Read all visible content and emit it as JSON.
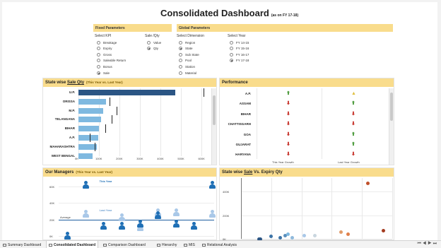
{
  "header": {
    "title": "Consolidated Dashboard",
    "subtitle": "(as on FY 17-18)"
  },
  "fixed_params": {
    "title": "Fixed Parameters",
    "kpi_label": "Select KPI",
    "unit_label": "Sale /Qty",
    "kpi_options": [
      "Breakage",
      "Expiry",
      "Gross",
      "Saleable Return",
      "Bonus",
      "Sale"
    ],
    "kpi_selected": "Sale",
    "unit_options": [
      "Value",
      "Qty"
    ],
    "unit_selected": "Qty"
  },
  "global_params": {
    "title": "Global Parameters",
    "dimension_label": "Select Dimension",
    "year_label": "Select Year",
    "dimension_options": [
      "Region",
      "State",
      "Sub State",
      "Pool",
      "Station",
      "Material"
    ],
    "dimension_selected": "State",
    "year_options": [
      "FY 14-15",
      "FY 15-16",
      "FY 16-17",
      "FY 17-18"
    ],
    "year_selected": "FY 17-18"
  },
  "state_sales": {
    "title_pre": "State wise",
    "title_kpi": "Sale Qty",
    "note": "(This Year vs. Last Year)",
    "axis_ticks": [
      "0K",
      "100K",
      "200K",
      "300K",
      "400K",
      "500K",
      "600K"
    ],
    "rows": [
      {
        "state": "U.P.",
        "this_year": 470000,
        "last_year": 610000,
        "highlight": true
      },
      {
        "state": "ORISSA",
        "this_year": 135000,
        "last_year": 150000
      },
      {
        "state": "M.P.",
        "this_year": 120000,
        "last_year": 185000
      },
      {
        "state": "TELANGANA",
        "this_year": 110000,
        "last_year": 160000
      },
      {
        "state": "BIHAR",
        "this_year": 100000,
        "last_year": 130000
      },
      {
        "state": "A.P.",
        "this_year": 95000,
        "last_year": 55000
      },
      {
        "state": "MAHARASHTRA",
        "this_year": 90000,
        "last_year": 80000
      },
      {
        "state": "WEST BENGAL",
        "this_year": 70000,
        "last_year": null
      }
    ]
  },
  "performance": {
    "title": "Performance",
    "col_this": "This Year Growth",
    "col_last": "Last Year Growth",
    "rows": [
      {
        "state": "A.P.",
        "this_year": "up",
        "last_year": "warn"
      },
      {
        "state": "ASSAM",
        "this_year": "down",
        "last_year": "up"
      },
      {
        "state": "BIHAR",
        "this_year": "down",
        "last_year": "down"
      },
      {
        "state": "CHATTISGARH",
        "this_year": "down",
        "last_year": "down"
      },
      {
        "state": "GOA",
        "this_year": "down",
        "last_year": "up"
      },
      {
        "state": "GUJARAT",
        "this_year": "down",
        "last_year": "up"
      },
      {
        "state": "HARYANA",
        "this_year": "down",
        "last_year": "down"
      }
    ]
  },
  "managers": {
    "title": "Our Managers",
    "note": "(This Year vs. Last Year)",
    "this_year_label": "This Year",
    "last_year_label": "Last Year",
    "average_label": "Average",
    "y_ticks": [
      "60K",
      "40K",
      "20K",
      "0K"
    ],
    "this_year_values": [
      0,
      62000,
      12000,
      12000,
      15000,
      25000,
      15000,
      12000,
      62000
    ],
    "last_year_values": [
      null,
      27000,
      null,
      22000,
      10000,
      28000,
      28000,
      12000,
      27000
    ],
    "average": 20000,
    "colors": {
      "this_year": "#1f6fb5",
      "last_year": "#a9c8e8"
    }
  },
  "sale_vs_expiry": {
    "title_pre": "State wise",
    "title_kpi": "Sale",
    "title_post": "Vs. Expiry Qty",
    "y_ticks": [
      "400K",
      "200K",
      "0K"
    ],
    "points": [
      {
        "x": 0.12,
        "y": 0,
        "color": "#2b5584"
      },
      {
        "x": 0.13,
        "y": 0,
        "color": "#2b5584"
      },
      {
        "x": 0.2,
        "y": 20000,
        "color": "#3d73a6"
      },
      {
        "x": 0.26,
        "y": 10000,
        "color": "#3d73a6"
      },
      {
        "x": 0.29,
        "y": 25000,
        "color": "#5a8fbc"
      },
      {
        "x": 0.31,
        "y": 40000,
        "color": "#7fb9e0"
      },
      {
        "x": 0.34,
        "y": 10000,
        "color": "#8fb9dc"
      },
      {
        "x": 0.42,
        "y": 30000,
        "color": "#a9c8e8"
      },
      {
        "x": 0.49,
        "y": 30000,
        "color": "#c9d6df"
      },
      {
        "x": 0.66,
        "y": 55000,
        "color": "#e09b6a"
      },
      {
        "x": 0.71,
        "y": 40000,
        "color": "#e07f4a"
      },
      {
        "x": 0.84,
        "y": 470000,
        "color": "#c0502a"
      },
      {
        "x": 0.94,
        "y": 70000,
        "color": "#a33b1f"
      }
    ],
    "colors": {
      "low": "#2b5584",
      "high": "#a33b1f"
    }
  },
  "tabs": [
    {
      "label": "Summary Dashboard",
      "active": false
    },
    {
      "label": "Consolidated Dashboard",
      "active": true
    },
    {
      "label": "Comparison Dashboard",
      "active": false
    },
    {
      "label": "Hierarchy",
      "active": false
    },
    {
      "label": "MIS",
      "active": false
    },
    {
      "label": "Relational Analysis",
      "active": false
    }
  ]
}
